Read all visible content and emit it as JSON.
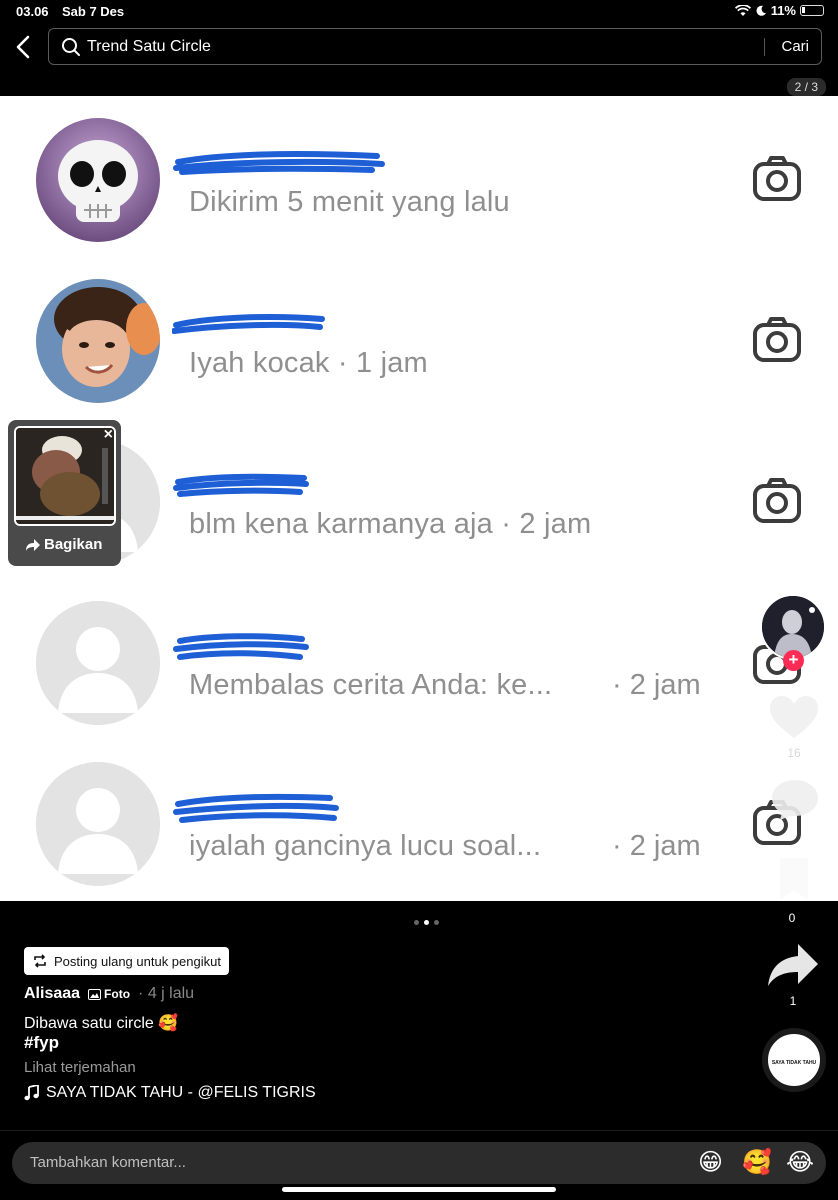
{
  "status_bar": {
    "time": "03.06",
    "date": "Sab 7 Des",
    "battery": "11%"
  },
  "search": {
    "query": "Trend Satu Circle",
    "button": "Cari"
  },
  "page_counter": "2 / 3",
  "messages": [
    {
      "text": "Dikirim 5 menit yang lalu",
      "time": ""
    },
    {
      "text": "Iyah kocak · 1 jam",
      "time": ""
    },
    {
      "text": "blm kena karmanya aja · 2 jam",
      "time": ""
    },
    {
      "text": "Membalas cerita Anda: ke...",
      "time": "· 2 jam"
    },
    {
      "text": "iyalah gancinya lucu soal...",
      "time": "· 2 jam"
    }
  ],
  "share_popup": {
    "close": "×",
    "label": "Bagikan"
  },
  "rail": {
    "like_count": "16",
    "bookmark_count": "0",
    "share_count": "1",
    "music_disc_label": "SAYA TIDAK TAHU"
  },
  "post": {
    "repost_label": "Posting ulang untuk pengikut",
    "author": "Alisaaa",
    "type_badge": "Foto",
    "time": "· 4 j lalu",
    "caption": "Dibawa satu circle 🥰",
    "hashtag": "#fyp",
    "translate": "Lihat terjemahan",
    "music": "SAYA TIDAK TAHU - @FELIS TIGRIS"
  },
  "comment": {
    "placeholder": "Tambahkan komentar...",
    "emojis": [
      "😁",
      "🥰",
      "😂"
    ]
  },
  "colors": {
    "scribble": "#1f5fd6",
    "accent": "#fe2c55"
  }
}
